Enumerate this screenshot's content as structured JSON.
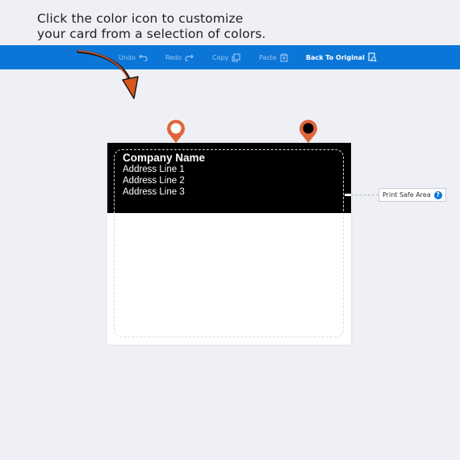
{
  "instruction": {
    "line1": "Click the color icon to customize",
    "line2": "your card from a selection of colors."
  },
  "toolbar": {
    "undo_label": "Undo",
    "redo_label": "Redo",
    "copy_label": "Copy",
    "paste_label": "Paste",
    "back_label": "Back To Original"
  },
  "card": {
    "company": "Company Name",
    "address": [
      "Address Line 1",
      "Address Line 2",
      "Address Line 3"
    ]
  },
  "safe_area": {
    "label": "Print Safe Area",
    "help_icon": "?"
  },
  "colors": {
    "toolbar": "#0b76d8",
    "pin": "#e0653a",
    "header_fill": "#000000",
    "body_fill": "#ffffff",
    "arrow": "#d9571f"
  },
  "icons": [
    "undo-icon",
    "redo-icon",
    "copy-icon",
    "paste-icon",
    "reset-icon",
    "help-icon",
    "color-pin-icon"
  ]
}
